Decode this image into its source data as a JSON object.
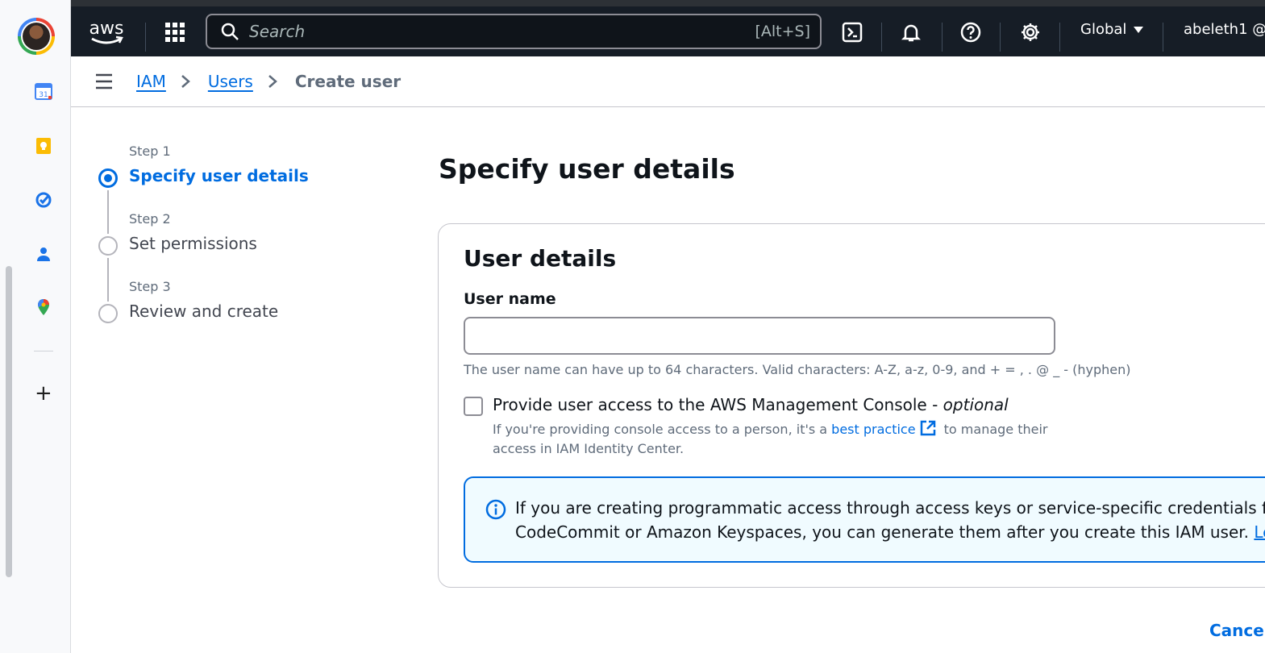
{
  "topbar": {
    "logo_text": "aws",
    "search_placeholder": "Search",
    "search_shortcut": "[Alt+S]",
    "region": "Global",
    "account": "abeleth1 @"
  },
  "breadcrumb": {
    "items": [
      "IAM",
      "Users"
    ],
    "current": "Create user"
  },
  "steps": [
    {
      "number": "Step 1",
      "title": "Specify user details",
      "state": "active"
    },
    {
      "number": "Step 2",
      "title": "Set permissions",
      "state": "pending"
    },
    {
      "number": "Step 3",
      "title": "Review and create",
      "state": "pending"
    }
  ],
  "page_title": "Specify user details",
  "user_details": {
    "heading": "User details",
    "username_label": "User name",
    "username_value": "",
    "username_hint": "The user name can have up to 64 characters. Valid characters: A-Z, a-z, 0-9, and + = , . @ _ - (hyphen)",
    "console_access_label": "Provide user access to the AWS Management Console - ",
    "console_access_optional": "optional",
    "console_access_checked": false,
    "console_desc_before": "If you're providing console access to a person, it's a ",
    "console_desc_link": "best practice",
    "console_desc_after": " to manage their access in IAM Identity Center.",
    "info_line1": "If you are creating programmatic access through access keys or service-specific credentials for AWS",
    "info_line2": "CodeCommit or Amazon Keyspaces, you can generate them after you create this IAM user. ",
    "info_link": "Learn more"
  },
  "actions": {
    "cancel": "Cancel"
  },
  "colors": {
    "nav_bg": "#161d26",
    "accent": "#006ce0",
    "info_bg": "#f0fbff"
  }
}
